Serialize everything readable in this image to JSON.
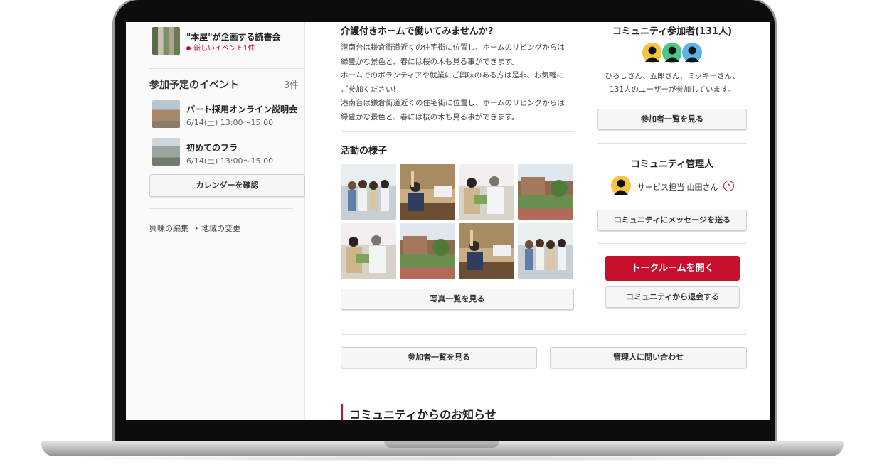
{
  "sidebar": {
    "featured_event": {
      "title": "\"本屋\"が企画する読書会",
      "badge": "新しいイベント1件"
    },
    "upcoming": {
      "heading": "参加予定のイベント",
      "count": "3件",
      "events": [
        {
          "title": "パート採用オンライン説明会",
          "date": "6/14(土) 13:00〜15:00"
        },
        {
          "title": "初めてのフラ",
          "date": "6/14(土) 13:00〜15:00"
        }
      ],
      "calendar_button": "カレンダーを確認"
    },
    "links": {
      "edit_interests": "興味の編集",
      "separator": "・",
      "change_region": "地域の変更"
    }
  },
  "main": {
    "intro_title": "介護付きホームで働いてみませんか?",
    "intro_lines": [
      "港南台は鎌倉街道近くの住宅街に位置し、ホームのリビングからは",
      "緑豊かな景色と、春には桜の木も見る事ができます。",
      "ホームでのボランティアや就業にご興味のある方は是非、お気軽に",
      "ご参加ください!",
      "港南台は鎌倉街道近くの住宅街に位置し、ホームのリビングからは",
      "緑豊かな景色と、春には桜の木も見る事ができます。"
    ],
    "activity_title": "活動の様子",
    "photos_button": "写真一覧を見る",
    "bottom_buttons": {
      "members": "参加者一覧を見る",
      "contact_admin": "管理人に問い合わせ"
    },
    "news_title": "コミュニティからのお知らせ"
  },
  "right": {
    "members_title": "コミュニティ参加者(131人)",
    "members_text_1": "ひろしさん、五郎さん、ミッキーさん、",
    "members_text_2": "131人のユーザーが参加しています。",
    "members_button": "参加者一覧を見る",
    "admin_title": "コミュニティ管理人",
    "admin_name": "サービス担当 山田さん",
    "message_button": "コミュニティにメッセージを送る",
    "talkroom_button": "トークルームを開く",
    "leave_button": "コミュニティから退会する"
  },
  "colors": {
    "accent": "#c8102e",
    "avatar_yellow": "#f4c542",
    "avatar_green": "#4cc58a",
    "avatar_blue": "#5bb3e6"
  }
}
